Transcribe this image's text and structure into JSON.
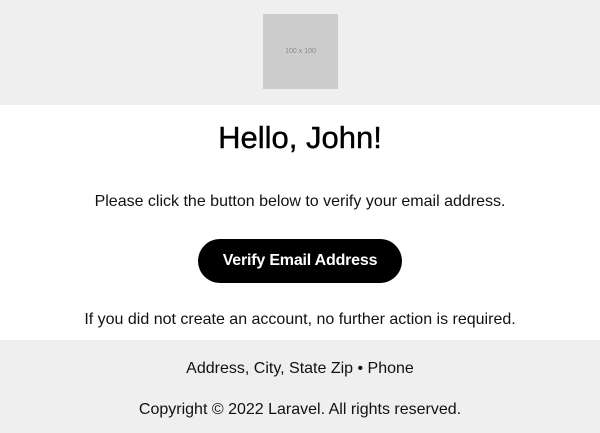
{
  "header": {
    "logo_placeholder": "100 x 100"
  },
  "content": {
    "greeting": "Hello, John!",
    "intro": "Please click the button below to verify your email address.",
    "button_label": "Verify Email Address",
    "outro": "If you did not create an account, no further action is required."
  },
  "footer": {
    "address": "Address, City, State Zip • Phone",
    "copyright": "Copyright © 2022 Laravel. All rights reserved."
  },
  "colors": {
    "band_background": "#efefef",
    "placeholder_gray": "#cccccc",
    "button_background": "#000000",
    "button_text": "#ffffff"
  }
}
